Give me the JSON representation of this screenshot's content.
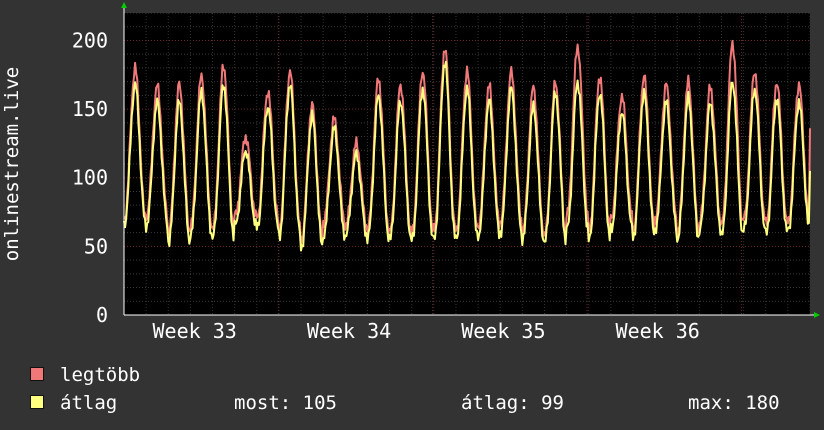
{
  "chart_data": {
    "type": "line",
    "ylabel": "onlinestream.live",
    "ylim": [
      0,
      220
    ],
    "yticks": [
      0,
      50,
      100,
      150,
      200
    ],
    "xlim": [
      0,
      1
    ],
    "xticks": [
      {
        "pos": 0.103,
        "label": "Week 33"
      },
      {
        "pos": 0.328,
        "label": "Week 34"
      },
      {
        "pos": 0.553,
        "label": "Week 35"
      },
      {
        "pos": 0.778,
        "label": "Week 36"
      }
    ],
    "grid": true,
    "cycles": 31,
    "series": [
      {
        "name": "legtöbb",
        "color": "#f07878",
        "peaks": [
          180,
          167,
          168,
          174,
          182,
          130,
          163,
          178,
          153,
          143,
          125,
          172,
          168,
          178,
          195,
          178,
          167,
          177,
          166,
          170,
          196,
          174,
          160,
          174,
          168,
          170,
          166,
          198,
          178,
          170,
          168
        ],
        "troughs": [
          70,
          72,
          60,
          65,
          62,
          72,
          70,
          62,
          55,
          68,
          65,
          62,
          60,
          60,
          62,
          62,
          65,
          68,
          60,
          58,
          72,
          60,
          70,
          62,
          70,
          60,
          68,
          66,
          70,
          66,
          68
        ]
      },
      {
        "name": "átlag",
        "color": "#ffff80",
        "peaks": [
          168,
          155,
          155,
          162,
          168,
          120,
          152,
          168,
          145,
          136,
          117,
          160,
          156,
          165,
          185,
          165,
          156,
          165,
          152,
          162,
          170,
          162,
          148,
          162,
          155,
          158,
          154,
          170,
          165,
          158,
          155
        ],
        "troughs": [
          66,
          65,
          53,
          58,
          56,
          65,
          63,
          57,
          49,
          58,
          58,
          56,
          55,
          54,
          55,
          56,
          58,
          60,
          55,
          53,
          62,
          54,
          62,
          57,
          63,
          55,
          62,
          58,
          62,
          59,
          62
        ]
      }
    ],
    "legend_position": "bottom",
    "stats": {
      "most_label": "most:",
      "most_value": "105",
      "atlag_label": "átlag:",
      "atlag_value": "99",
      "max_label": "max:",
      "max_value": "180"
    }
  }
}
